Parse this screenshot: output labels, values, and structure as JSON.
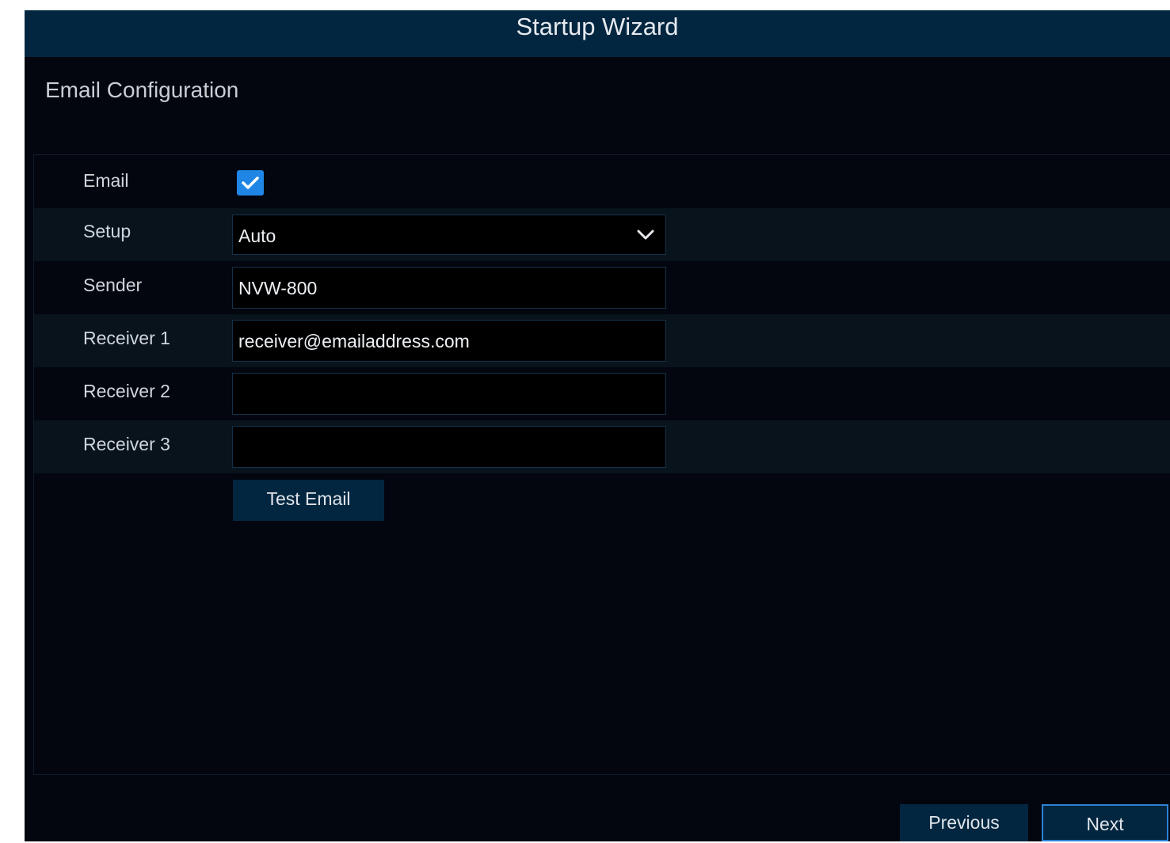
{
  "window": {
    "title": "Startup Wizard"
  },
  "section": {
    "title": "Email Configuration"
  },
  "form": {
    "email": {
      "label": "Email",
      "checked": true
    },
    "setup": {
      "label": "Setup",
      "value": "Auto"
    },
    "sender": {
      "label": "Sender",
      "value": "NVW-800"
    },
    "receiver1": {
      "label": "Receiver 1",
      "value": "receiver@emailaddress.com"
    },
    "receiver2": {
      "label": "Receiver 2",
      "value": ""
    },
    "receiver3": {
      "label": "Receiver 3",
      "value": ""
    },
    "test_email_label": "Test Email"
  },
  "footer": {
    "previous_label": "Previous",
    "next_label": "Next"
  },
  "colors": {
    "titlebar": "#032640",
    "background": "#03060f",
    "checkbox": "#1f86e6",
    "next_border": "#2c83d6"
  }
}
